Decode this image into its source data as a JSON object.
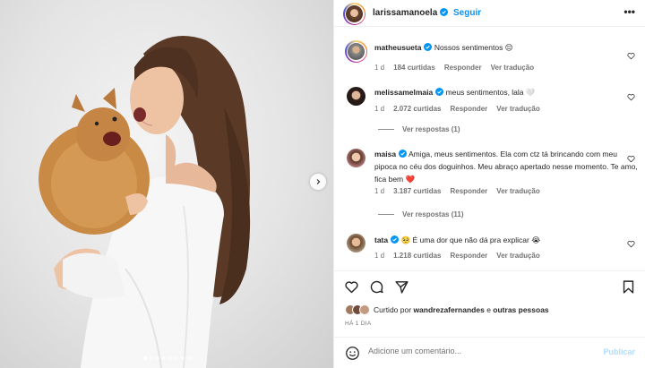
{
  "post": {
    "username": "larissamanoela",
    "separator": "•",
    "follow_label": "Seguir",
    "more_label": "•••"
  },
  "comments": [
    {
      "username": "matheusueta",
      "verified": true,
      "text": "Nossos sentimentos 😔",
      "time": "1 d",
      "likes": "184 curtidas",
      "reply_label": "Responder",
      "translate_label": "Ver tradução"
    },
    {
      "username": "melissamelmaia",
      "verified": true,
      "text": "meus sentimentos, lala 🤍",
      "time": "1 d",
      "likes": "2.072 curtidas",
      "reply_label": "Responder",
      "translate_label": "Ver tradução",
      "view_replies": "Ver respostas (1)"
    },
    {
      "username": "maisa",
      "verified": true,
      "text": "Amiga, meus sentimentos. Ela com ctz tá brincando com meu pipoca no céu dos doguinhos. Meu abraço apertado nesse momento. Te amo, fica bem ❤️",
      "time": "1 d",
      "likes": "3.187 curtidas",
      "reply_label": "Responder",
      "translate_label": "Ver tradução",
      "view_replies": "Ver respostas (11)"
    },
    {
      "username": "tata",
      "verified": true,
      "text": "🥺 É uma dor que não dá pra explicar 😭",
      "time": "1 d",
      "likes": "1.218 curtidas",
      "reply_label": "Responder",
      "translate_label": "Ver tradução"
    }
  ],
  "liked_by": {
    "prefix": "Curtido por",
    "user": "wandrezafernandes",
    "connector": "e",
    "others": "outras pessoas"
  },
  "date": "HÁ 1 DIA",
  "add_comment": {
    "placeholder": "Adicione um comentário...",
    "publish_label": "Publicar"
  },
  "colors": {
    "accent": "#0095f6",
    "verified": "#0095f6",
    "publish_disabled": "#b3dbff",
    "muted": "#737373"
  },
  "icons": [
    "chevron-right-icon",
    "verified-icon",
    "heart-icon",
    "comment-icon",
    "share-icon",
    "bookmark-icon",
    "emoji-icon",
    "more-icon"
  ]
}
